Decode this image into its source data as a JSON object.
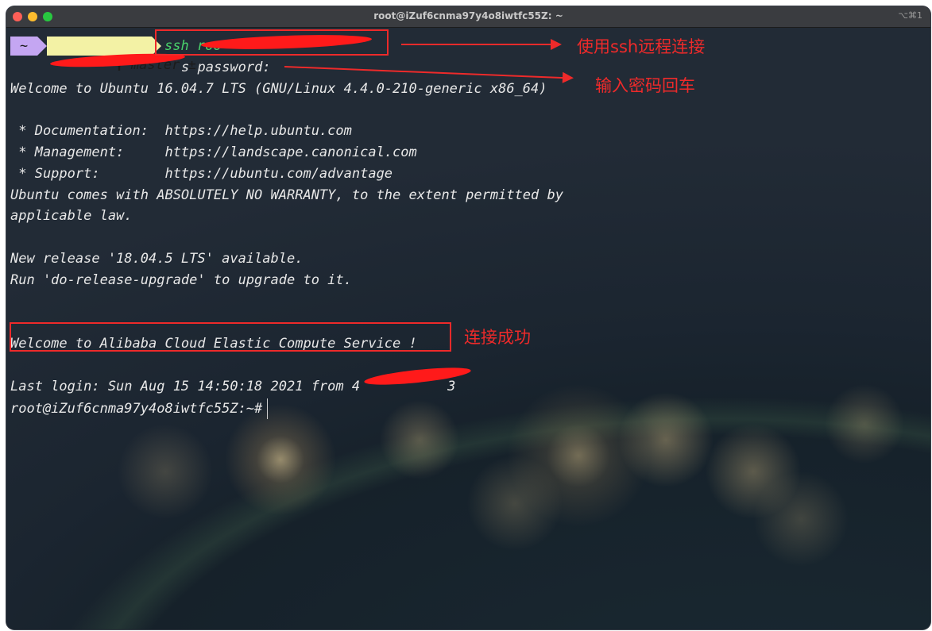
{
  "window": {
    "title": "root@iZuf6cnma97y4o8iwtfc55Z: ~",
    "shortcut": "⌥⌘1"
  },
  "prompt": {
    "tilde": "~",
    "branch_icon": "git-branch-icon",
    "branch": "master ±",
    "command": "ssh roo"
  },
  "terminal": {
    "password_line": "s password:",
    "welcome": "Welcome to Ubuntu 16.04.7 LTS (GNU/Linux 4.4.0-210-generic x86_64)",
    "doc": " * Documentation:  https://help.ubuntu.com",
    "mgmt": " * Management:     https://landscape.canonical.com",
    "support": " * Support:        https://ubuntu.com/advantage",
    "warranty1": "Ubuntu comes with ABSOLUTELY NO WARRANTY, to the extent permitted by",
    "warranty2": "applicable law.",
    "release1": "New release '18.04.5 LTS' available.",
    "release2": "Run 'do-release-upgrade' to upgrade to it.",
    "alibaba": "Welcome to Alibaba Cloud Elastic Compute Service !",
    "last_login": "Last login: Sun Aug 15 14:50:18 2021 from 4",
    "last_login_tail": "3",
    "shell_prompt": "root@iZuf6cnma97y4o8iwtfc55Z:~#"
  },
  "annotations": {
    "ssh": "使用ssh远程连接",
    "password": "输入密码回车",
    "success": "连接成功"
  },
  "colors": {
    "annotation": "#ee2a2a",
    "command": "#49d36b",
    "prompt_tilde_bg": "#c4a6f2",
    "prompt_branch_bg": "#f3f2a5"
  }
}
